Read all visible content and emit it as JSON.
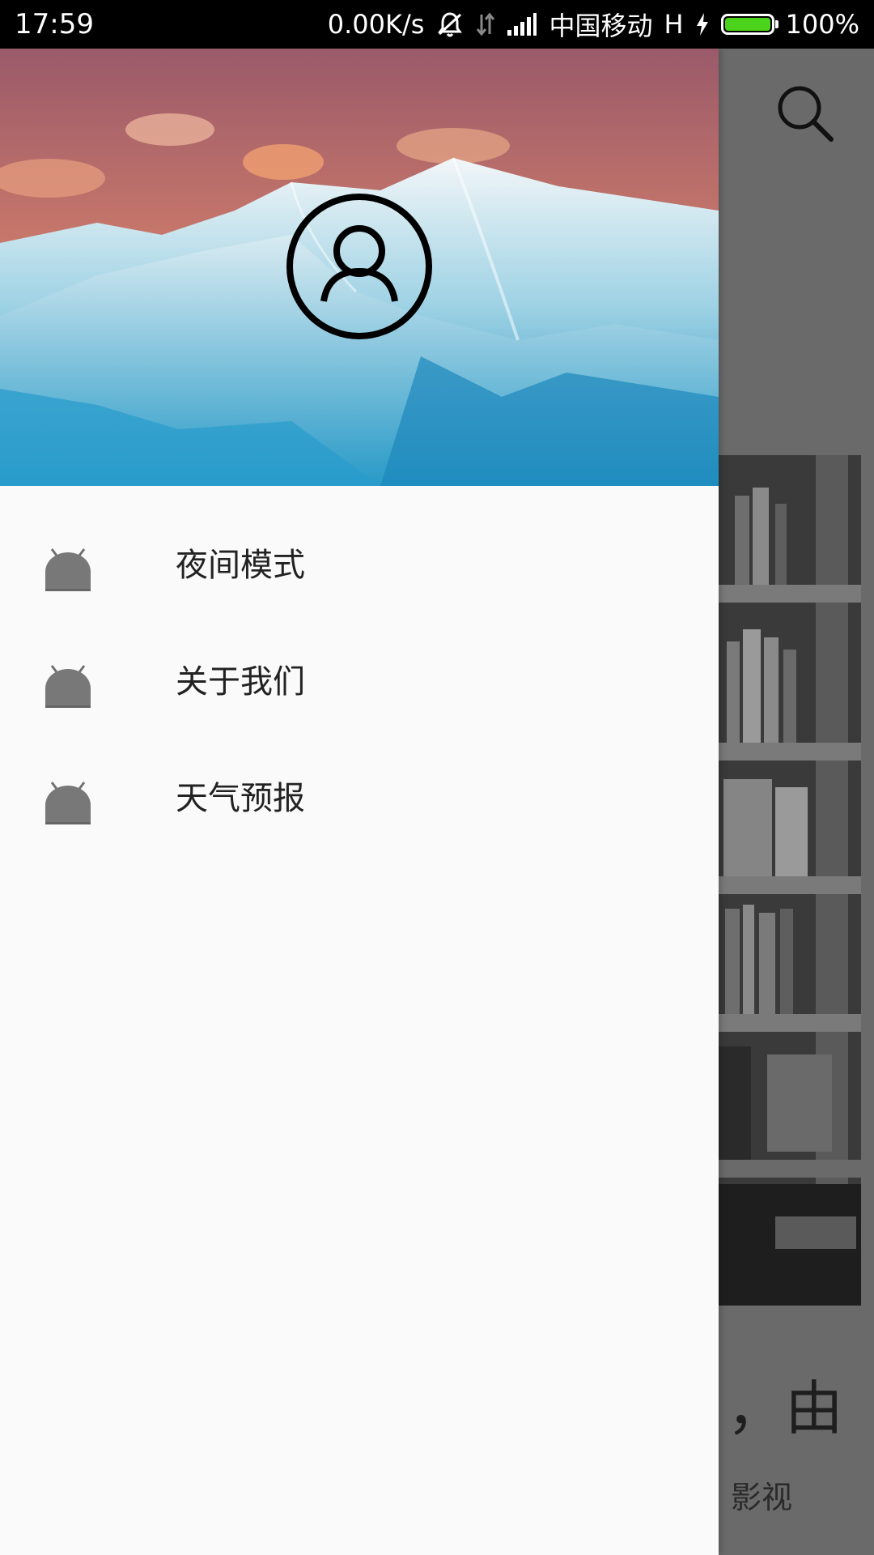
{
  "status_bar": {
    "time": "17:59",
    "speed": "0.00K/s",
    "carrier": "中国移动",
    "network": "H",
    "battery": "100%"
  },
  "drawer": {
    "menu_items": [
      {
        "label": "夜间模式",
        "icon": "android-icon"
      },
      {
        "label": "关于我们",
        "icon": "android-icon"
      },
      {
        "label": "天气预报",
        "icon": "android-icon"
      }
    ]
  },
  "background": {
    "title_fragment": "，由",
    "subtitle_fragment": "影视"
  },
  "colors": {
    "drawer_bg": "#fafafa",
    "status_bar": "#000000",
    "battery_fill": "#4cd41c",
    "scrim": "#6a6a6a"
  }
}
